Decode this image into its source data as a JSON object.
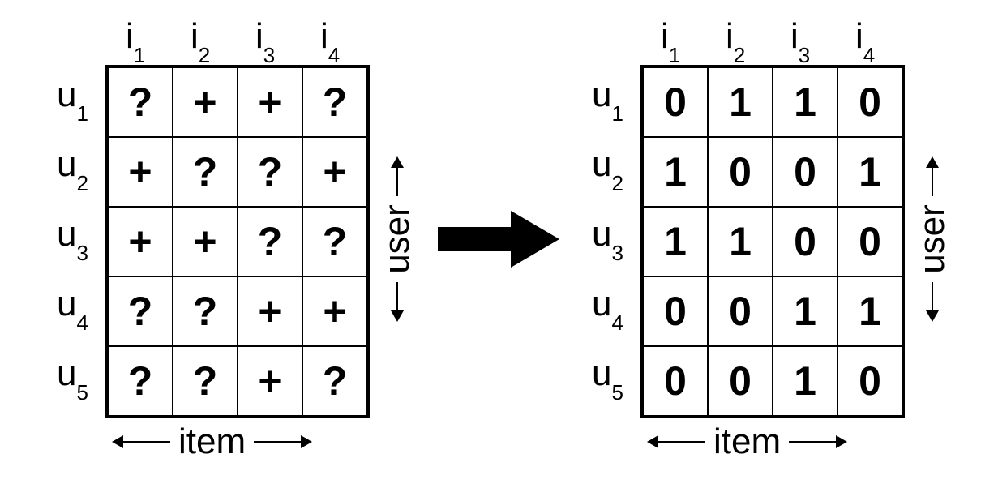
{
  "diagram": {
    "item_axis_label": "item",
    "user_axis_label": "user",
    "col_headers": [
      {
        "base": "i",
        "sub": "1"
      },
      {
        "base": "i",
        "sub": "2"
      },
      {
        "base": "i",
        "sub": "3"
      },
      {
        "base": "i",
        "sub": "4"
      }
    ],
    "row_headers": [
      {
        "base": "u",
        "sub": "1"
      },
      {
        "base": "u",
        "sub": "2"
      },
      {
        "base": "u",
        "sub": "3"
      },
      {
        "base": "u",
        "sub": "4"
      },
      {
        "base": "u",
        "sub": "5"
      }
    ],
    "left_matrix": [
      [
        "?",
        "+",
        "+",
        "?"
      ],
      [
        "+",
        "?",
        "?",
        "+"
      ],
      [
        "+",
        "+",
        "?",
        "?"
      ],
      [
        "?",
        "?",
        "+",
        "+"
      ],
      [
        "?",
        "?",
        "+",
        "?"
      ]
    ],
    "right_matrix": [
      [
        "0",
        "1",
        "1",
        "0"
      ],
      [
        "1",
        "0",
        "0",
        "1"
      ],
      [
        "1",
        "1",
        "0",
        "0"
      ],
      [
        "0",
        "0",
        "1",
        "1"
      ],
      [
        "0",
        "0",
        "1",
        "0"
      ]
    ]
  }
}
